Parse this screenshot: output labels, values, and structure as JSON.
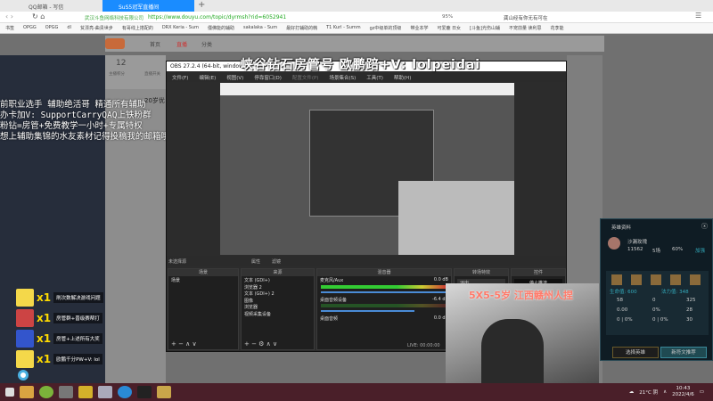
{
  "browser": {
    "tabs": [
      {
        "label": "QQ邮箱 - 写信"
      },
      {
        "label": "SuS5冠军直播间"
      }
    ],
    "site_name": "武汉斗鱼网络科技有限公司",
    "url": "https://www.douyu.com/topic/dyrmsh?rid=6052941",
    "zoom": "95%",
    "search_text": "龚山经有你无有可在",
    "bookmarks": [
      "书签",
      "OPGG",
      "OPGG",
      "dl",
      "贫漂亮-曲贵世步",
      "有哥线上搭配的",
      "DRX Keria - Sum",
      "僵佛能的辅助",
      "sakalaka - Sum",
      "最好打辅助的韩",
      "T1 Kurl - Summ",
      "gz中级单的顶级",
      "带业本学",
      "可爱鹿 日女",
      "[斗鱼]光伤山辅",
      "不宠前量 读利思",
      "花李能"
    ]
  },
  "douyu": {
    "nav": [
      "首页",
      "直播",
      "分类"
    ],
    "stats": {
      "count": "12",
      "count_label": "主播积分",
      "toggle_label": "直播开关"
    },
    "card_title": "20岁优",
    "banner": "峡谷钻石房管号 欧鹏踣+V: lolpeidai",
    "overlay_lines": [
      "前职业选手 辅助绝活哥 精通所有辅助",
      "办卡加V: SupportCarryQAQ上铁粉群",
      "粉钻=房管+免费教学一小时+专属特权",
      "想上辅助集锦的水友素材记得投稿我的邮箱哦"
    ],
    "gifts": [
      {
        "count": "x1",
        "text": "刷次数解决游戏问题"
      },
      {
        "count": "x1",
        "text": "房管群+晋级赛帮打"
      },
      {
        "count": "x1",
        "text": "房管+上述所有大奖"
      },
      {
        "count": "x1",
        "text": "欧鹏千分PW+V: lol"
      }
    ]
  },
  "obs": {
    "title": "OBS 27.2.4 (64-bit, windows) -",
    "menu": [
      "文件(F)",
      "编辑(E)",
      "视图(V)",
      "停靠窗口(D)",
      "配置文件(P)",
      "场景集合(S)",
      "工具(T)",
      "帮助(H)"
    ],
    "source_label": "未选择源",
    "props": "属性",
    "filters": "滤镜",
    "docks": {
      "scenes": "场景",
      "sources": "来源",
      "mixer": "混音器",
      "transitions": "转场特效",
      "controls": "控件"
    },
    "scene_items": [
      "场景"
    ],
    "sources": [
      "文本 (GDI+)",
      "浏览器 2",
      "文本 (GDI+) 2",
      "图像",
      "浏览器",
      "视频采集设备"
    ],
    "mixer": [
      {
        "name": "麦克风/Aux",
        "db": "0.0 dB",
        "level": 0.6
      },
      {
        "name": "桌面音频设备",
        "db": "-6.4 dB",
        "level": 0.0
      },
      {
        "name": "桌面音频",
        "db": "0.0 dB",
        "level": 0.5
      }
    ],
    "transition": "淡出",
    "stop_button": "停止推流",
    "status": "LIVE: 00:00:00"
  },
  "camera_caption": "5X5-5岁 江西赣州人捏",
  "hero_panel": {
    "title": "英雄资料",
    "name": "沙漏玫瑰",
    "stats": [
      "11562",
      "5场",
      "60%"
    ],
    "link": "加强",
    "hp": "生命值: 600",
    "mp": "法力值: 348",
    "values": [
      "58",
      "0",
      "325",
      "0.00",
      "0%",
      "28",
      "0 | 0%",
      "0 | 0%",
      "30"
    ],
    "btn_select": "选择英雄",
    "btn_save": "新符文推荐"
  },
  "taskbar": {
    "weather": "21°C 阴",
    "time": "10:43",
    "date": "2022/4/6"
  }
}
